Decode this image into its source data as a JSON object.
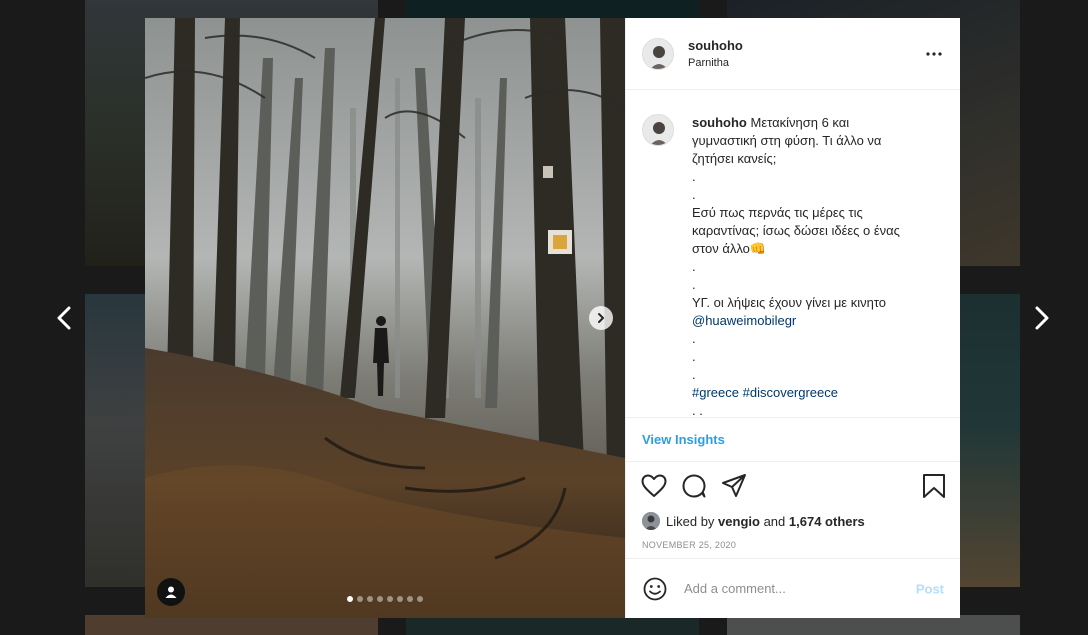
{
  "post": {
    "username": "souhoho",
    "location": "Parnitha",
    "caption": {
      "username": "souhoho",
      "lines": [
        "Μετακίνηση 6 και",
        "γυμναστική στη φύση. Τι άλλο να",
        "ζητήσει κανείς;",
        ".",
        ".",
        "Εσύ πως περνάς τις μέρες τις",
        "καραντίνας; ίσως δώσει ιδέες ο ένας",
        "στον άλλο👊",
        ".",
        ".",
        "ΥΓ. οι λήψεις έχουν γίνει με κινητο"
      ],
      "mention": "@huaweimobilegr",
      "lines_after": [
        ".",
        ".",
        "."
      ],
      "hashtags": [
        "#greece",
        "#discovergreece"
      ],
      "trailing": ". ."
    },
    "view_insights": "View Insights",
    "likes": {
      "prefix": "Liked by",
      "user": "vengio",
      "middle": "and",
      "others": "1,674 others"
    },
    "date": "NOVEMBER 25, 2020",
    "comment": {
      "placeholder": "Add a comment...",
      "post_label": "Post"
    },
    "carousel": {
      "total_slides": 8,
      "active_index": 0
    }
  },
  "colors": {
    "link": "#00376b",
    "insights": "#2c9fe0",
    "post_disabled": "#b2dffc"
  },
  "icons": {
    "prev": "chevron-left-icon",
    "next": "chevron-right-icon",
    "more": "more-horizontal-icon",
    "like": "heart-icon",
    "comment": "comment-icon",
    "share": "send-icon",
    "save": "bookmark-icon",
    "emoji": "emoji-icon",
    "tag": "user-tag-icon"
  }
}
